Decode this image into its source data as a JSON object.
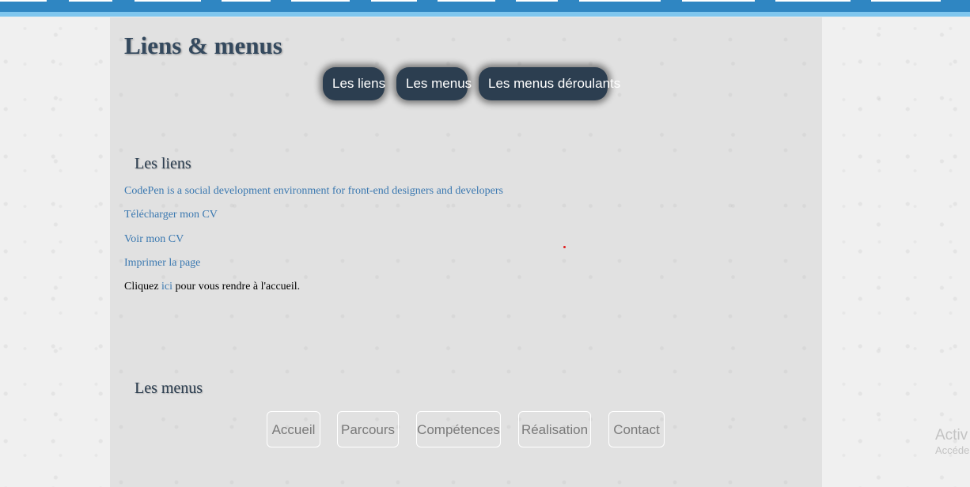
{
  "page": {
    "title": "Liens & menus"
  },
  "nav_pills": [
    {
      "label": "Les liens"
    },
    {
      "label": "Les menus"
    },
    {
      "label": "Les menus déroulants"
    }
  ],
  "links_section": {
    "heading": "Les liens",
    "links": [
      {
        "label": "CodePen is a social development environment for front-end designers and developers"
      },
      {
        "label": "Télécharger mon CV"
      },
      {
        "label": "Voir mon CV"
      },
      {
        "label": "Imprimer la page"
      }
    ],
    "sentence": {
      "before": "Cliquez ",
      "link": "ici",
      "after": " pour vous rendre à l'accueil."
    }
  },
  "menus_section": {
    "heading": "Les menus",
    "items": [
      {
        "label": "Accueil"
      },
      {
        "label": "Parcours"
      },
      {
        "label": "Compétences"
      },
      {
        "label": "Réalisation"
      },
      {
        "label": "Contact"
      }
    ]
  },
  "watermark": {
    "line1": "Activ",
    "line2": "Accéde"
  },
  "colors": {
    "topbar": "#2f86c2",
    "topbar_border": "#7fc6ee",
    "pill_background": "#2c3e50",
    "link": "#3a78b0"
  }
}
